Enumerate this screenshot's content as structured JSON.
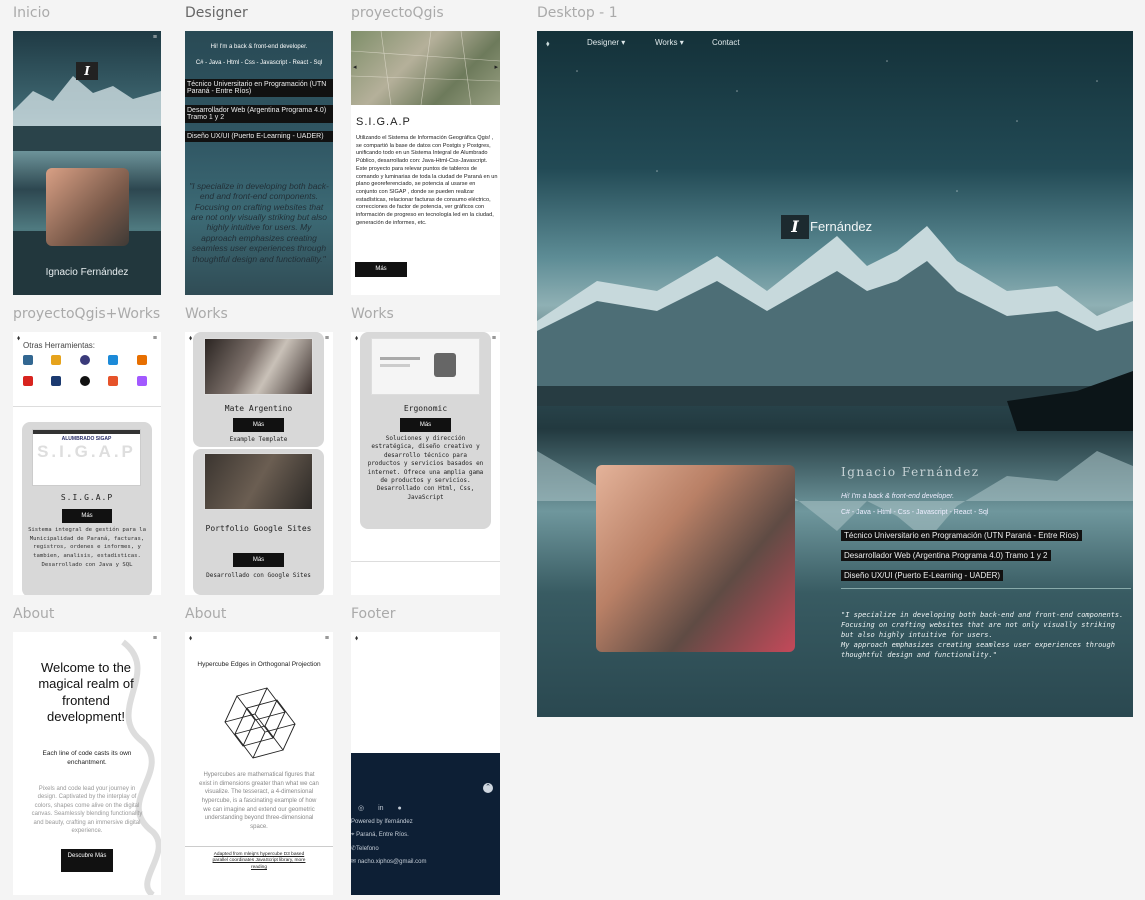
{
  "frames": {
    "inicio": "Inicio",
    "designer": "Designer",
    "proyecto_qgis": "proyectoQgis",
    "desktop": "Desktop - 1",
    "proyecto_qgis_works": "proyectoQgis+Works",
    "works_a": "Works",
    "works_b": "Works",
    "about_a": "About",
    "about_b": "About",
    "footer": "Footer"
  },
  "inicio": {
    "logo": "I",
    "name": "Ignacio Fernández"
  },
  "designer_panel": {
    "intro": "Hi! I'm a back & front-end developer.",
    "stack": "C# - Java - Html - Css - Javascript - React - Sql",
    "chips": [
      "Técnico Universitario en Programación (UTN Paraná - Entre Ríos)",
      "Desarrollador Web (Argentina Programa 4.0) Tramo 1 y 2",
      "Diseño UX/UI (Puerto E-Learning - UADER)"
    ],
    "quote": "\"I specialize in developing both back-end and front-end components. Focusing on crafting websites that are not only visually striking but also highly intuitive for users. My approach emphasizes creating seamless user experiences through thoughtful design and functionality.\""
  },
  "qgis": {
    "title": "S.I.G.A.P",
    "body": "Utilizando el Sistema de Información Geográfica Qgis! , se compartió la base de datos con Postgis y Postgres, unificando todo en un Sistema Integral de Alumbrado Público, desarrollado con: Java-Html-Css-Javascript. Este proyecto para relevar puntos de tableros de comando y luminarias de toda la ciudad de Paraná en un plano georeferenciado, se potencia al usarse en conjunto con SIGAP , donde se pueden realizar estadísticas, relacionar facturas de consumo eléctrico, correcciones de factor de potencia, ver gráficos con información de progreso en tecnología led en la ciudad, generación de informes, etc.",
    "button": "Más"
  },
  "desktop": {
    "nav": {
      "designer": "Designer ▾",
      "works": "Works ▾",
      "contact": "Contact"
    },
    "logo": "I",
    "hero_name": "Fernández",
    "name": "Ignacio Fernández",
    "intro": "Hi! I'm a back & front-end developer.",
    "stack": "C# - Java - Html - Css - Javascript - React - Sql",
    "chips": [
      "Técnico Universitario en Programación (UTN Paraná - Entre Ríos)",
      "Desarrollador Web (Argentina Programa 4.0) Tramo 1 y 2",
      "Diseño UX/UI (Puerto E-Learning - UADER)"
    ],
    "quote": "\"I specialize in developing both back-end and front-end components. Focusing on crafting websites that are not only visually striking but also highly intuitive for users.\nMy approach emphasizes creating seamless user experiences through thoughtful design and functionality.\""
  },
  "qgis_works": {
    "tools_title": "Otras Herramientas:",
    "card_title": "S.I.G.A.P",
    "thumb_text": "S.I.G.A.P",
    "thumb_brand": "ALUMBRADO SIGAP",
    "button": "Más",
    "desc": "Sistema integral de gestión para la Municipalidad de Paraná, facturas, registros, ordenes e informes, y tambien, analisis, estadisticas. Desarrollado con Java y SQL"
  },
  "works_a": {
    "card1_title": "Mate Argentino",
    "card1_button": "Más",
    "card1_desc": "Example Template",
    "card2_title": "Portfolio Google Sites",
    "card2_button": "Más",
    "card2_desc": "Desarrollado con Google Sites"
  },
  "works_b": {
    "title": "Ergonomic",
    "button": "Más",
    "desc": "Soluciones y dirección estratégica, diseño creativo y desarrollo técnico para productos y servicios basados en internet. Ofrece una amplia gama de productos y servicios. Desarrollado con Html, Css, JavaScript"
  },
  "about_a": {
    "heading": "Welcome to the magical realm of frontend development!",
    "sub": "Each line of code casts its own enchantment.",
    "body": "Pixels and code lead your journey in design. Captivated by the interplay of colors, shapes come alive on the digital canvas. Seamlessly blending functionality and beauty, crafting an immersive digital experience.",
    "button": "Descubre Más"
  },
  "about_b": {
    "title": "Hypercube Edges in Orthogonal Projection",
    "body": "Hypercubes are mathematical figures that exist in dimensions greater than what we can visualize. The tesseract, a 4-dimensional hypercube, is a fascinating example of how we can imagine and extend our geometric understanding beyond three-dimensional space.",
    "credit": "Adapted from mleip's hypercube D3 based parallel coordinates JavaScript library, more reading"
  },
  "footer": {
    "powered": "Powered by Ifernández",
    "location": "Paraná, Entre Ríos.",
    "phone": "Telefono",
    "email": "nacho.xiphos@gmail.com"
  }
}
